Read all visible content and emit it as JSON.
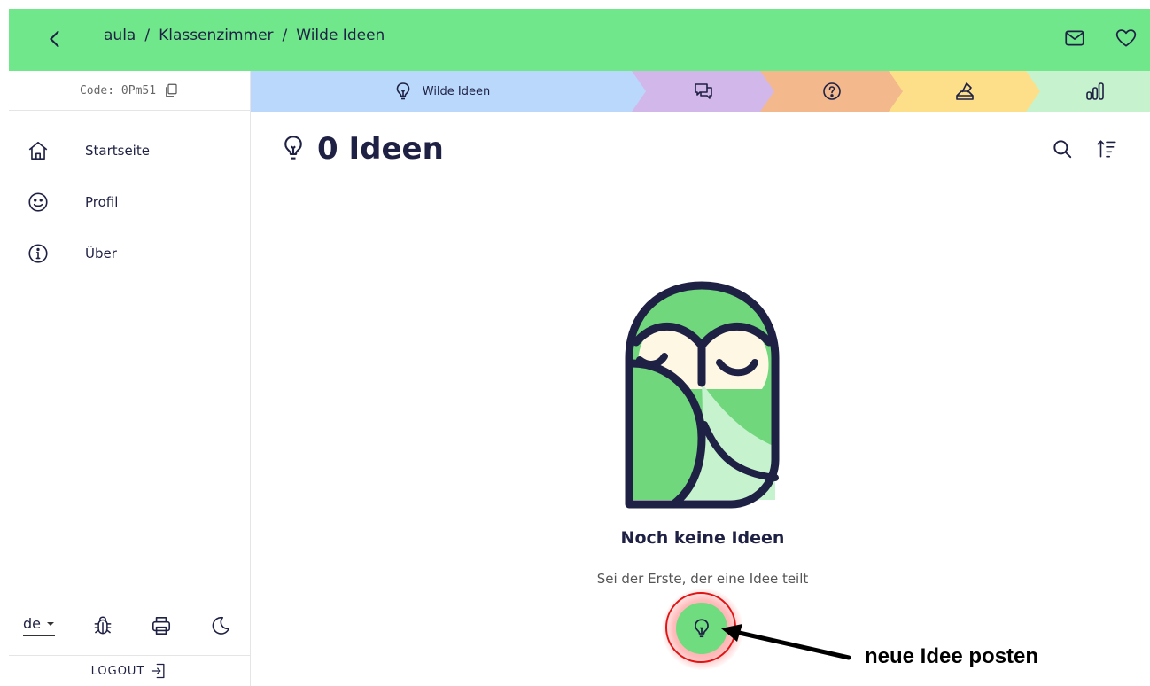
{
  "header": {
    "breadcrumb": [
      "aula",
      "Klassenzimmer",
      "Wilde Ideen"
    ],
    "separator": "/"
  },
  "sidebar": {
    "code_label": "Code: 0Pm51",
    "items": [
      {
        "label": "Startseite",
        "icon": "home-icon"
      },
      {
        "label": "Profil",
        "icon": "smiley-icon"
      },
      {
        "label": "Über",
        "icon": "info-icon"
      }
    ],
    "language": "de",
    "logout_label": "LOGOUT"
  },
  "phases": {
    "active_label": "Wilde Ideen",
    "colors": [
      "#b9d8fb",
      "#d2b8ea",
      "#f3b98d",
      "#fddf8a",
      "#c6f3cd"
    ]
  },
  "main": {
    "title": "0 Ideen",
    "empty_title": "Noch keine Ideen",
    "empty_subtitle": "Sei der Erste, der eine Idee teilt"
  },
  "annotation": {
    "label": "neue Idee posten"
  },
  "colors": {
    "topbar": "#70e78b",
    "ink": "#1f2144",
    "fab": "#6fdc7f",
    "highlight": "#e01414"
  }
}
